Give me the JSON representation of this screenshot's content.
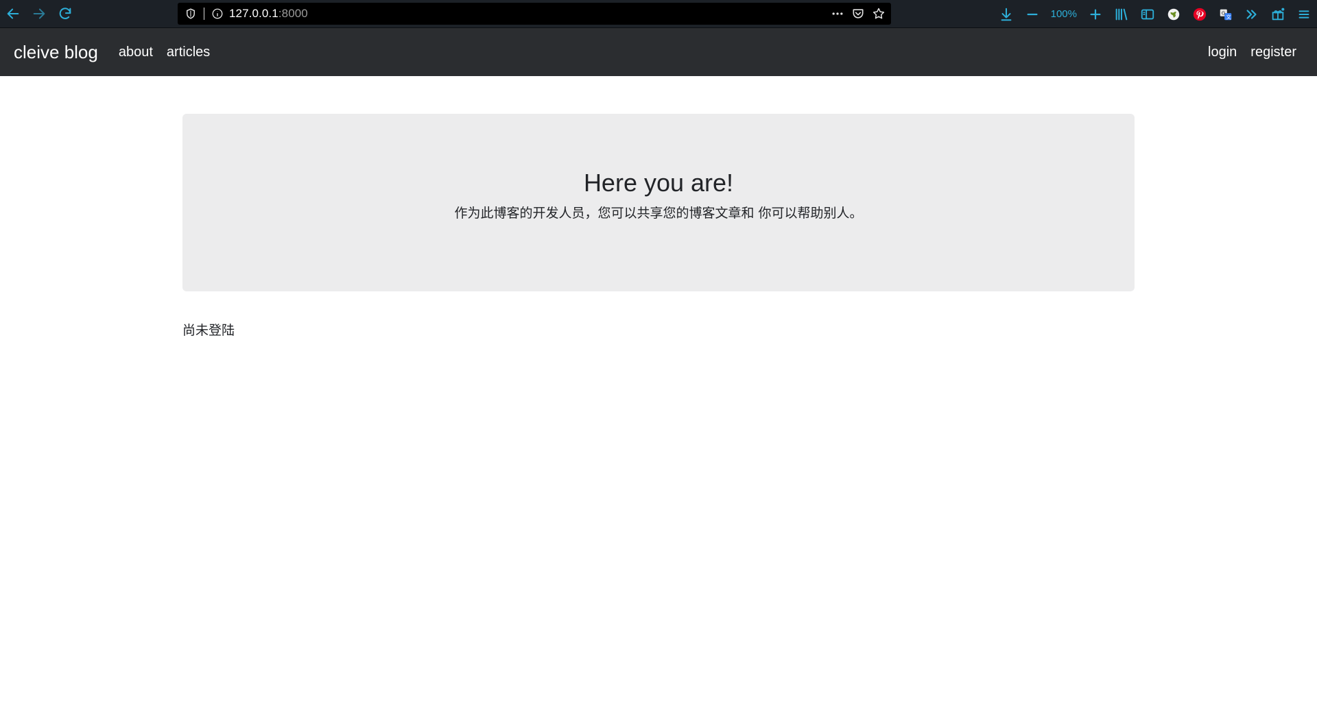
{
  "browser": {
    "url_host": "127.0.0.1",
    "url_port": ":8000",
    "zoom": "100%",
    "accent_color": "#2dafd9"
  },
  "navbar": {
    "brand": "cleive blog",
    "links": [
      {
        "label": "about"
      },
      {
        "label": "articles"
      }
    ],
    "right_links": [
      {
        "label": "login"
      },
      {
        "label": "register"
      }
    ]
  },
  "jumbotron": {
    "title": "Here you are!",
    "lead": "作为此博客的开发人员，您可以共享您的博客文章和 你可以帮助别人。"
  },
  "status": {
    "text": "尚未登陆"
  },
  "icons": {
    "back": "arrow-left-icon",
    "forward": "arrow-right-icon",
    "reload": "reload-icon",
    "shield": "shield-icon",
    "info": "info-icon",
    "more": "more-dots-icon",
    "pocket": "pocket-icon",
    "bookmark": "star-icon",
    "download": "download-icon",
    "zoom_out": "minus-icon",
    "zoom_in": "plus-icon",
    "library": "library-icon",
    "sidebar": "sidebar-icon",
    "extensions": [
      "extension-globe-icon",
      "pinterest-icon",
      "translate-icon"
    ],
    "overflow": "chevrons-right-icon",
    "gift": "gift-icon",
    "menu": "hamburger-menu-icon"
  }
}
